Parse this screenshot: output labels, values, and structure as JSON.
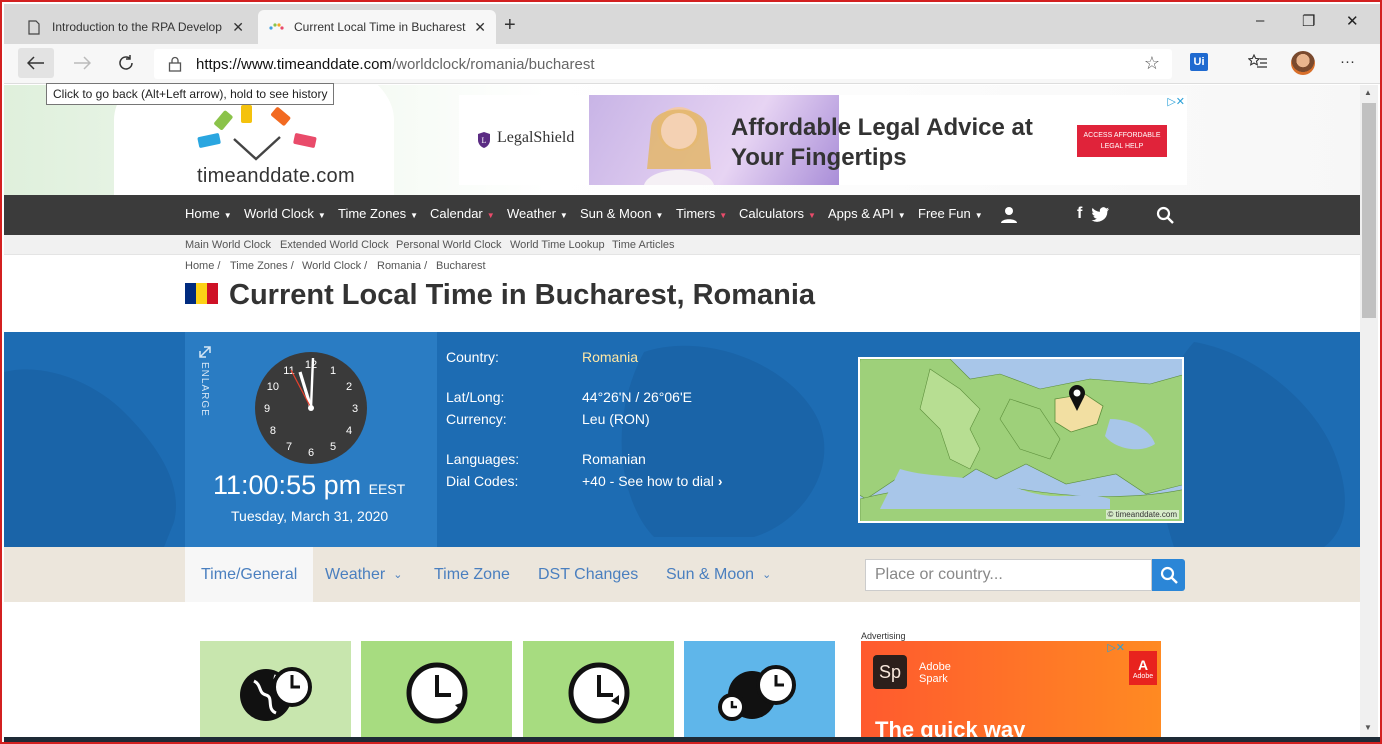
{
  "browser": {
    "tabs": [
      {
        "title": "Introduction to the RPA Develop",
        "close": "✕"
      },
      {
        "title": "Current Local Time in Bucharest,",
        "close": "✕"
      }
    ],
    "new_tab": "+",
    "window_controls": {
      "minimize": "–",
      "maximize": "❐",
      "close": "✕"
    },
    "url_host": "https://www.timeanddate.com",
    "url_path": "/worldclock/romania/bucharest",
    "tooltip": "Click to go back (Alt+Left arrow), hold to see history",
    "extension_label": "Ui",
    "menu": "···",
    "icons": [
      "back-icon",
      "forward-icon",
      "refresh-icon",
      "lock-icon",
      "star-icon",
      "favorites-icon",
      "profile-avatar",
      "more-icon"
    ]
  },
  "site": {
    "logo": "timeanddate.com",
    "ad_top": {
      "brand": "LegalShield",
      "headline_1": "Affordable Legal Advice at",
      "headline_2": "Your Fingertips",
      "cta": "ACCESS AFFORDABLE LEGAL HELP"
    },
    "nav": [
      "Home",
      "World Clock",
      "Time Zones",
      "Calendar",
      "Weather",
      "Sun & Moon",
      "Timers",
      "Calculators",
      "Apps & API",
      "Free Fun"
    ],
    "subnav": [
      "Main World Clock",
      "Extended World Clock",
      "Personal World Clock",
      "World Time Lookup",
      "Time Articles"
    ],
    "breadcrumb": [
      "Home /",
      "Time Zones /",
      "World Clock /",
      "Romania /",
      "Bucharest"
    ],
    "title": "Current Local Time in Bucharest, Romania",
    "flag_colors": [
      "#002b7f",
      "#fcd116",
      "#ce1126"
    ]
  },
  "clock": {
    "enlarge": "ENLARGE",
    "numerals": [
      "12",
      "1",
      "2",
      "3",
      "4",
      "5",
      "6",
      "7",
      "8",
      "9",
      "10",
      "11"
    ],
    "time": "11:00:55 pm",
    "zone": "EEST",
    "date": "Tuesday, March 31, 2020"
  },
  "info": {
    "country_label": "Country:",
    "country": "Romania",
    "latlong_label": "Lat/Long:",
    "latlong": "44°26'N / 26°06'E",
    "currency_label": "Currency:",
    "currency": "Leu (RON)",
    "languages_label": "Languages:",
    "languages": "Romanian",
    "dial_label": "Dial Codes:",
    "dial": "+40 - See how to dial",
    "map_credit": "© timeanddate.com"
  },
  "page_tabs": [
    "Time/General",
    "Weather",
    "Time Zone",
    "DST Changes",
    "Sun & Moon"
  ],
  "search": {
    "placeholder": "Place or country..."
  },
  "ad_side": {
    "label": "Advertising",
    "sp": "Sp",
    "brand_1": "Adobe",
    "brand_2": "Spark",
    "adobe": "Adobe",
    "headline": "The quick way"
  }
}
